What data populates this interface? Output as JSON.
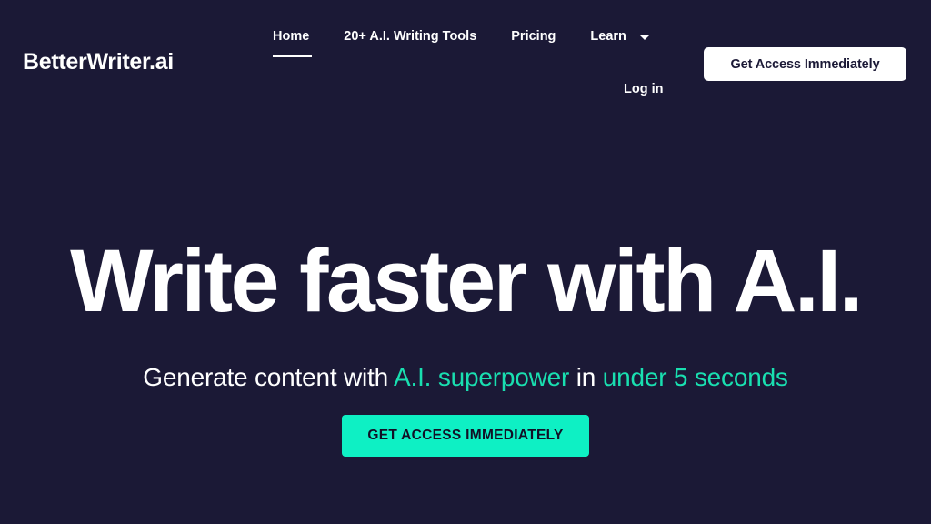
{
  "theme": {
    "background": "#1b1936",
    "text": "#ffffff",
    "accent_teal": "#19dfb0",
    "cta_green": "#0ef0c4",
    "cta_text_dark": "#121026",
    "header_button_bg": "#ffffff"
  },
  "header": {
    "brand": "BetterWriter.ai",
    "nav": [
      {
        "label": "Home",
        "active": true,
        "has_dropdown": false
      },
      {
        "label": "20+ A.I. Writing Tools",
        "active": false,
        "has_dropdown": false
      },
      {
        "label": "Pricing",
        "active": false,
        "has_dropdown": false
      },
      {
        "label": "Learn",
        "active": false,
        "has_dropdown": true
      }
    ],
    "login_label": "Log in",
    "cta_label": "Get Access Immediately",
    "dropdown_icon": "chevron-down-icon"
  },
  "hero": {
    "title": "Write faster with A.I.",
    "subtitle_parts": [
      {
        "text": "Generate content with ",
        "color": "white"
      },
      {
        "text": "A.I. superpower",
        "color": "teal"
      },
      {
        "text": " in ",
        "color": "white"
      },
      {
        "text": "under 5 seconds",
        "color": "teal"
      }
    ],
    "cta_label": "GET ACCESS IMMEDIATELY"
  }
}
